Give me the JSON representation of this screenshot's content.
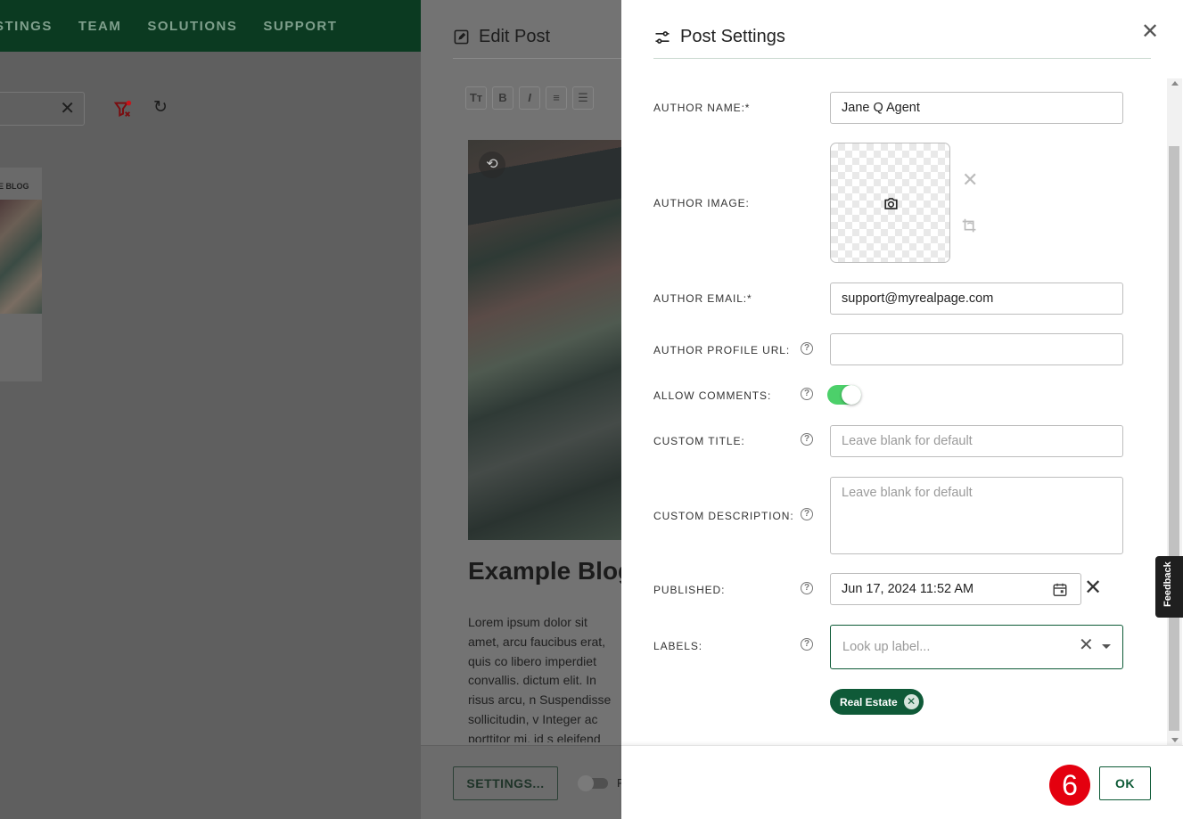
{
  "background_app": {
    "nav": [
      "STINGS",
      "TEAM",
      "SOLUTIONS",
      "SUPPORT"
    ],
    "card_title": "E BLOG"
  },
  "editor": {
    "title": "Edit Post",
    "toolbar": [
      "Tт",
      "B",
      "I",
      "≡",
      "☰"
    ],
    "post_title": "Example Blog",
    "body_text": "Lorem ipsum dolor sit amet, arcu faucibus erat, quis co libero imperdiet convallis. dictum elit. In risus arcu, n Suspendisse sollicitudin, v Integer ac porttitor mi, id s eleifend felis sed tristique",
    "settings_button": "SETTINGS...",
    "toggle_letter": "F"
  },
  "panel": {
    "title": "Post Settings",
    "fields": {
      "author_name": {
        "label": "AUTHOR NAME:*",
        "value": "Jane Q Agent"
      },
      "author_image": {
        "label": "AUTHOR IMAGE:"
      },
      "author_email": {
        "label": "AUTHOR EMAIL:*",
        "value": "support@myrealpage.com"
      },
      "author_profile_url": {
        "label": "AUTHOR PROFILE URL:",
        "value": ""
      },
      "allow_comments": {
        "label": "ALLOW COMMENTS:",
        "checked": true
      },
      "custom_title": {
        "label": "CUSTOM TITLE:",
        "placeholder": "Leave blank for default"
      },
      "custom_description": {
        "label": "CUSTOM DESCRIPTION:",
        "placeholder": "Leave blank for default"
      },
      "published": {
        "label": "PUBLISHED:",
        "value": "Jun 17, 2024 11:52 AM"
      },
      "labels": {
        "label": "LABELS:",
        "placeholder": "Look up label...",
        "chips": [
          "Real Estate"
        ]
      }
    },
    "ok_button": "OK",
    "step_badge": "6"
  },
  "feedback_tab": "Feedback",
  "colors": {
    "brand_green": "#0d5a36",
    "toggle_on": "#4cd06a",
    "badge_red": "#e4000f"
  }
}
